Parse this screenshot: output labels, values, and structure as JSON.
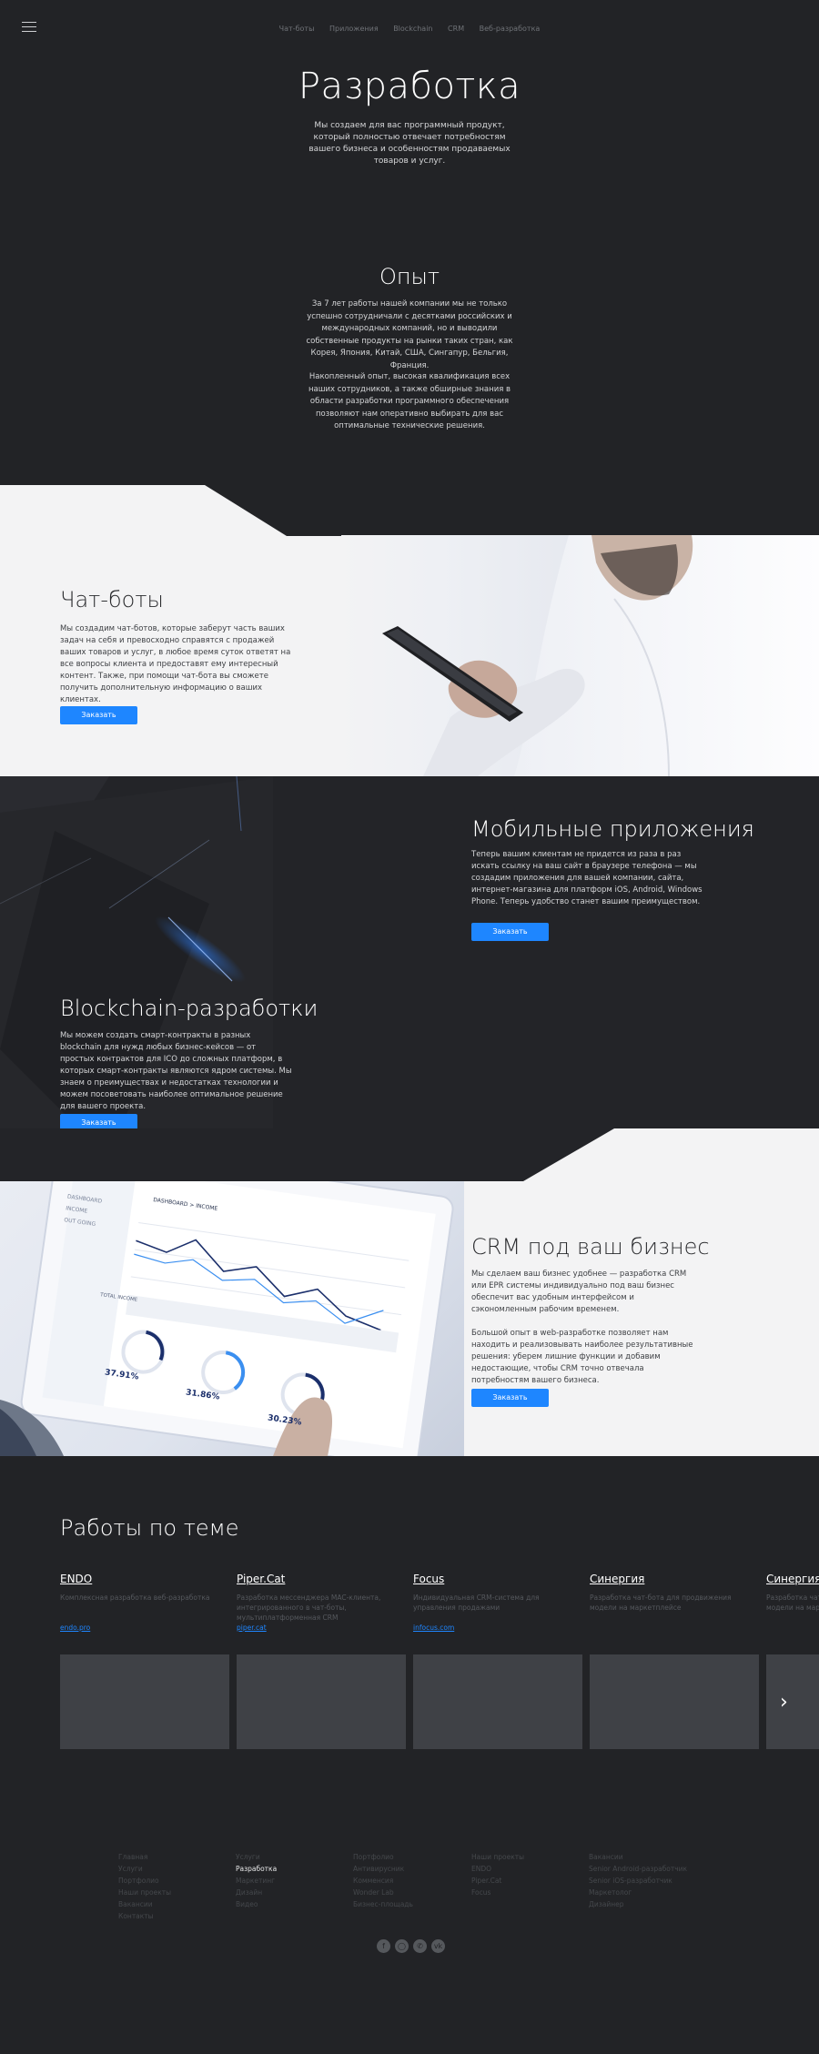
{
  "header": {
    "nav": [
      "Чат-боты",
      "Приложения",
      "Blockchain",
      "CRM",
      "Веб-разработка"
    ]
  },
  "hero": {
    "title": "Разработка",
    "description": "Мы создаем для вас программный продукт, который полностью отвечает потребностям вашего бизнеса и особенностям продаваемых товаров и услуг."
  },
  "experience": {
    "title": "Опыт",
    "p1": "За 7 лет работы нашей компании мы не только успешно сотрудничали с десятками российских и международных компаний, но и выводили собственные продукты на рынки таких стран, как Корея, Япония, Китай, США, Сингапур, Бельгия, Франция.",
    "p2": "Накопленный опыт, высокая квалификация всех наших сотрудников, а также обширные знания в области разработки программного обеспечения позволяют нам оперативно выбирать для вас оптимальные технические решения."
  },
  "chatbots": {
    "title": "Чат-боты",
    "text": "Мы создадим чат-ботов, которые заберут часть ваших задач на себя и превосходно справятся с продажей ваших товаров и услуг, в любое время суток ответят на все вопросы клиента и предоставят ему интересный контент. Также, при помощи чат-бота вы сможете получить дополнительную информацию о ваших клиентах.",
    "button": "Заказать"
  },
  "mobile": {
    "title": "Мобильные приложения",
    "text": "Теперь вашим клиентам не придется из раза в раз искать ссылку на ваш сайт в браузере телефона — мы создадим приложения для вашей компании, сайта, интернет-магазина для платформ iOS, Android, Windows Phone. Теперь удобство станет вашим преимуществом.",
    "button": "Заказать"
  },
  "blockchain": {
    "title": "Blockchain-разработки",
    "text": "Мы можем создать смарт-контракты в разных blockchain для нужд любых бизнес-кейсов — от простых контрактов для ICO до сложных платформ, в которых смарт-контракты являются ядром системы. Мы знаем о преимуществах и недостатках технологии и можем посоветовать наиболее оптимальное решение для вашего проекта.",
    "button": "Заказать"
  },
  "crm": {
    "title": "CRM под ваш бизнес",
    "p1": "Мы сделаем ваш бизнес удобнее — разработка CRM или EPR системы индивидуально под ваш бизнес обеспечит вас удобным интерфейсом и сэкономленным рабочим временем.",
    "p2": "Большой опыт в web-разработке позволяет нам находить и реализовывать наиболее результативные решения: уберем лишние функции и добавим недостающие, чтобы CRM точно отвечала потребностям вашего бизнеса.",
    "button": "Заказать",
    "dashboard": {
      "menu": [
        "DASHBOARD",
        "INCOME",
        "OUT GOING"
      ],
      "header": "DASHBOARD > INCOME",
      "tabs": [
        "DAILY",
        "WEEKLY",
        "MONTHLY"
      ],
      "stats": [
        "37.91%",
        "31.86%",
        "30.23%"
      ],
      "total_label": "TOTAL INCOME"
    }
  },
  "works": {
    "title": "Работы по теме",
    "items": [
      {
        "name": "ENDO",
        "desc": "Комплексная разработка веб-разработка",
        "link": "endo.pro"
      },
      {
        "name": "Piper.Cat",
        "desc": "Разработка мессенджера MAC-клиента, интегрированного в чат-боты, мультиплатформенная CRM",
        "link": "piper.cat"
      },
      {
        "name": "Focus",
        "desc": "Индивидуальная CRM-система для управления продажами",
        "link": "infocus.com"
      },
      {
        "name": "Синергия",
        "desc": "Разработка чат-бота для продвижения модели на маркетплейсе",
        "link": ""
      },
      {
        "name": "Синергия",
        "desc": "Разработка чат-бота для продвижения модели на маркетплейсе",
        "link": ""
      }
    ],
    "next_icon": "chevron-right-icon"
  },
  "footer": {
    "columns": [
      [
        "Главная",
        "Услуги",
        "Портфолио",
        "Наши проекты",
        "Вакансии",
        "Контакты"
      ],
      [
        "Услуги",
        "Разработка",
        "Маркетинг",
        "Дизайн",
        "Видео"
      ],
      [
        "Портфолио",
        "Антивирусник",
        "Комменсия",
        "Wonder Lab",
        "Бизнес-площадь"
      ],
      [
        "Наши проекты",
        "ENDO",
        "Piper.Cat",
        "Focus"
      ],
      [
        "Вакансии",
        "Senior Android-разработчик",
        "Senior iOS-разработчик",
        "Маркетолог",
        "Дизайнер"
      ]
    ],
    "active": "Разработка",
    "social": [
      "facebook-icon",
      "instagram-icon",
      "phone-icon",
      "vk-icon"
    ]
  },
  "colors": {
    "accent": "#1e86ff",
    "dark_bg": "#222326",
    "light_bg": "#f3f3f4",
    "thumb": "#3f4146"
  }
}
